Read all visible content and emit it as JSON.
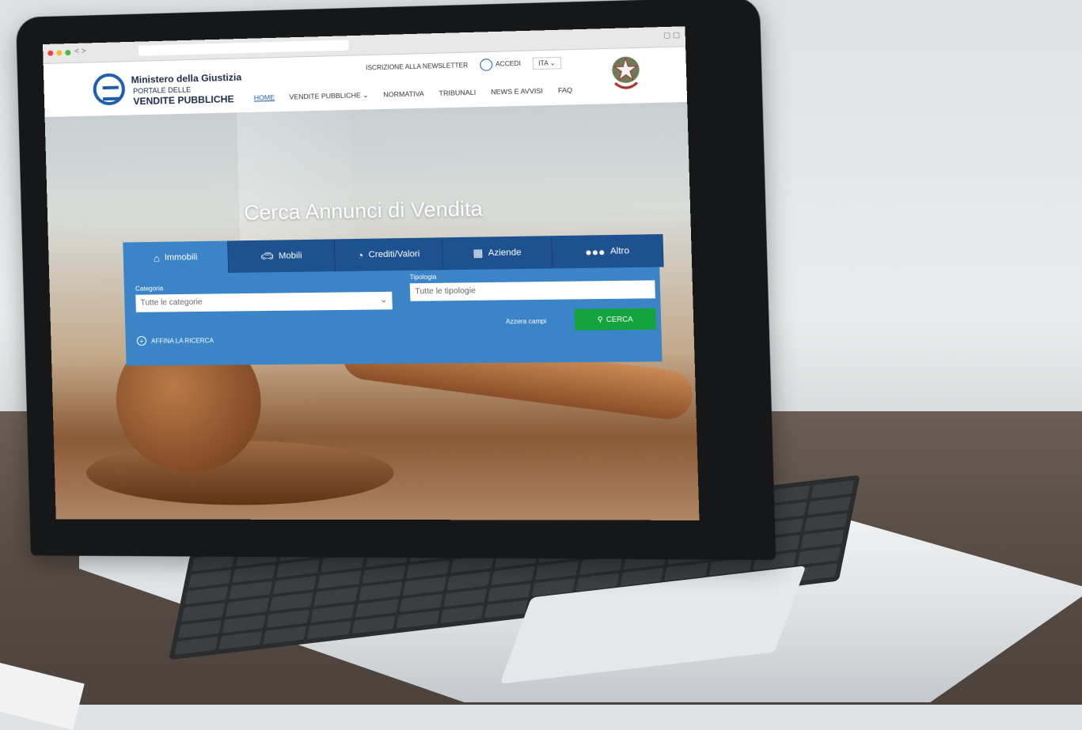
{
  "browser": {
    "nav": "< >"
  },
  "brand": {
    "org": "Ministero della Giustizia",
    "subtitle_top": "PORTALE DELLE",
    "subtitle_bottom": "VENDITE PUBBLICHE"
  },
  "top_links": {
    "newsletter": "ISCRIZIONE ALLA NEWSLETTER",
    "login": "ACCEDI",
    "language": "ITA"
  },
  "menu": [
    "HOME",
    "VENDITE PUBBLICHE",
    "NORMATIVA",
    "TRIBUNALI",
    "NEWS E AVVISI",
    "FAQ"
  ],
  "hero": {
    "title": "Cerca Annunci di Vendita"
  },
  "tabs": [
    {
      "label": "Immobili",
      "icon": "home-icon",
      "active": true
    },
    {
      "label": "Mobili",
      "icon": "car-icon",
      "active": false
    },
    {
      "label": "Crediti/Valori",
      "icon": "pie-chart-icon",
      "active": false
    },
    {
      "label": "Aziende",
      "icon": "building-icon",
      "active": false
    },
    {
      "label": "Altro",
      "icon": "more-dots-icon",
      "active": false
    }
  ],
  "search": {
    "category_label": "Categoria",
    "category_value": "Tutte le categorie",
    "type_label": "Tipologia",
    "type_value": "Tutte le tipologie",
    "reset": "Azzera campi",
    "submit": "CERCA",
    "refine": "AFFINA LA RICERCA"
  },
  "colors": {
    "tab_active": "#3b84c8",
    "tab_inactive": "#1e5190",
    "submit": "#13a33c",
    "brand_blue": "#1f5fa8"
  }
}
